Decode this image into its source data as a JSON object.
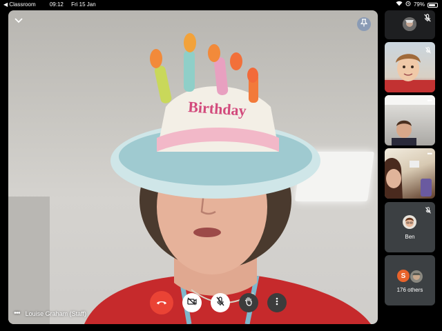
{
  "status_bar": {
    "back_app": "Classroom",
    "time": "09:12",
    "date": "Fri 15 Jan",
    "battery": "79%",
    "battery_level": 0.79
  },
  "main_video": {
    "participant_name": "Louise Graham (Staff)",
    "hat_text": "Birthday"
  },
  "icons": {
    "collapse": "chevron-down-icon",
    "pin": "pin-icon",
    "more": "more-horizontal-icon",
    "end_call": "phone-hangup-icon",
    "camera": "camera-off-icon",
    "mic": "mic-off-icon",
    "hand": "raise-hand-icon",
    "options": "more-vertical-icon",
    "self_mic": "mic-off-icon"
  },
  "colors": {
    "end_call": "#ea4335",
    "tile_bg": "#3c4043",
    "pin_bg": "#8a9bb5",
    "others_avatar": "#e8632b"
  },
  "side_tiles": {
    "ben": {
      "name": "Ben"
    },
    "others": {
      "avatar_letter": "S",
      "label": "176 others"
    }
  }
}
